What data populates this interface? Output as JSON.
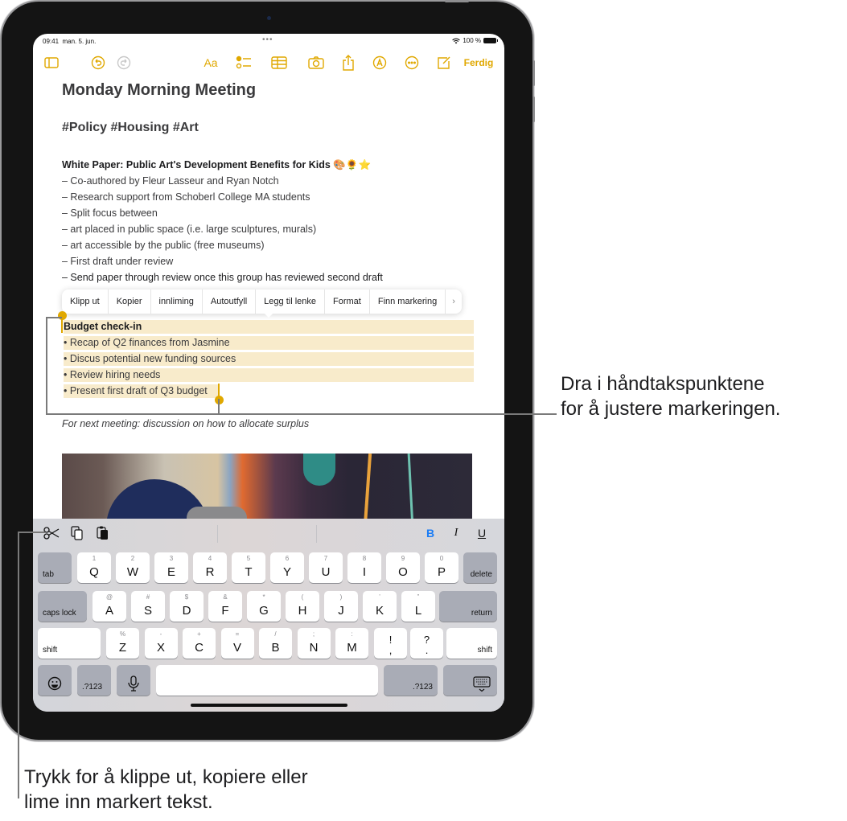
{
  "status_bar": {
    "time": "09:41",
    "date": "man. 5. jun.",
    "battery": "100 %"
  },
  "toolbar": {
    "icons": [
      "sidebar-icon",
      "undo-icon",
      "redo-icon",
      "text-format-icon",
      "checklist-icon",
      "table-icon",
      "camera-icon",
      "share-icon",
      "markup-icon",
      "more-icon",
      "compose-icon"
    ],
    "format_label": "Aa",
    "done_label": "Ferdig",
    "accent_color": "#e0a800"
  },
  "note": {
    "title": "Monday Morning Meeting",
    "tags": "#Policy #Housing #Art",
    "section_heading": "White Paper: Public Art's Development Benefits for Kids",
    "section_emojis": "🎨🌻⭐",
    "lines": [
      "– Co-authored by Fleur Lasseur and Ryan Notch",
      "– Research support from Schoberl College MA students",
      "– Split focus between",
      "– art placed in public space (i.e. large sculptures, murals)",
      "– art accessible by the public (free museums)",
      "– First draft under review",
      "– Send paper through review once this group has reviewed second draft"
    ],
    "selected": {
      "heading": "Budget check-in",
      "items": [
        "• Recap of Q2 finances from Jasmine",
        "• Discus potential new funding sources",
        "• Review hiring needs",
        "• Present first draft of Q3 budget"
      ]
    },
    "footer": "For next meeting: discussion on how to allocate surplus"
  },
  "edit_menu": {
    "items": [
      "Klipp ut",
      "Kopier",
      "innliming",
      "Autoutfyll",
      "Legg til lenke",
      "Format",
      "Finn markering"
    ],
    "more": "›"
  },
  "shortcut_bar": {
    "left": [
      "cut-icon",
      "copy-icon",
      "paste-icon"
    ],
    "bold": "B",
    "italic": "I",
    "underline": "U",
    "bold_color": "#1a7cf5"
  },
  "keyboard": {
    "row1": {
      "left": "tab",
      "right": "delete",
      "keys": [
        [
          "Q",
          "1"
        ],
        [
          "W",
          "2"
        ],
        [
          "E",
          "3"
        ],
        [
          "R",
          "4"
        ],
        [
          "T",
          "5"
        ],
        [
          "Y",
          "6"
        ],
        [
          "U",
          "7"
        ],
        [
          "I",
          "8"
        ],
        [
          "O",
          "9"
        ],
        [
          "P",
          "0"
        ]
      ]
    },
    "row2": {
      "left": "caps lock",
      "right": "return",
      "keys": [
        [
          "A",
          "@"
        ],
        [
          "S",
          "#"
        ],
        [
          "D",
          "$"
        ],
        [
          "F",
          "&"
        ],
        [
          "G",
          "*"
        ],
        [
          "H",
          "("
        ],
        [
          "J",
          ")"
        ],
        [
          "K",
          "’"
        ],
        [
          "L",
          "”"
        ]
      ]
    },
    "row3": {
      "left": "shift",
      "right": "shift",
      "keys": [
        [
          "Z",
          "%"
        ],
        [
          "X",
          "-"
        ],
        [
          "C",
          "+"
        ],
        [
          "V",
          "="
        ],
        [
          "B",
          "/"
        ],
        [
          "N",
          ";"
        ],
        [
          "M",
          ":"
        ]
      ],
      "punct": [
        [
          "!",
          ","
        ],
        [
          "?",
          "."
        ]
      ]
    },
    "row4": {
      "numbers_left": ".?123",
      "numbers_right": ".?123"
    }
  },
  "callouts": {
    "handles": "Dra i håndtakspunktene\nfor å justere markeringen.",
    "handles_line1": "Dra i håndtakspunktene",
    "handles_line2": "for å justere markeringen.",
    "shortcuts_line1": "Trykk for å klippe ut, kopiere eller",
    "shortcuts_line2": "lime inn markert tekst."
  }
}
